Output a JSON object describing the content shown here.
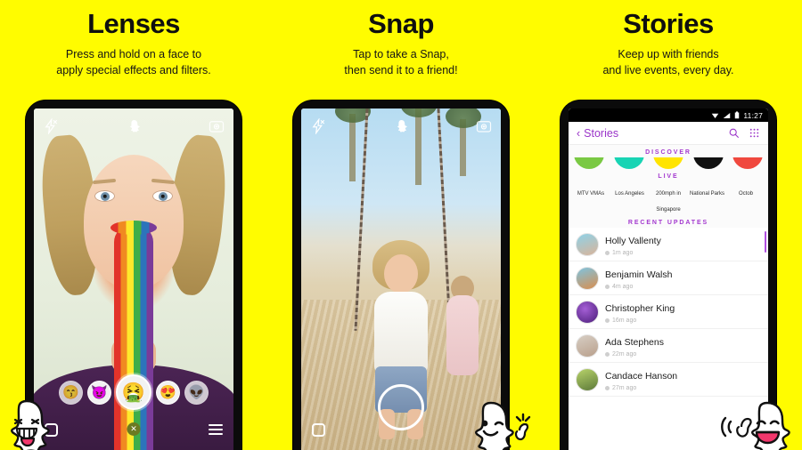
{
  "background_color": "#FFFC00",
  "panels": [
    {
      "id": "lenses",
      "title": "Lenses",
      "subtitle_line1": "Press and hold on a face to",
      "subtitle_line2": "apply special effects and filters.",
      "camera": {
        "flash_icon": "flash-off-icon",
        "logo_icon": "snapchat-ghost-icon",
        "add_friend_icon": "add-friend-camera-icon",
        "gallery_icon": "memories-gallery-icon",
        "menu_icon": "hamburger-menu-icon",
        "close_lens_icon": "close-lens-icon",
        "lenses": [
          {
            "name": "lens-kiss",
            "glyph": "😙"
          },
          {
            "name": "lens-devil",
            "glyph": "😈"
          },
          {
            "name": "lens-rainbow-vomit",
            "glyph": "🤮",
            "selected": true
          },
          {
            "name": "lens-hearts",
            "glyph": "😍"
          },
          {
            "name": "lens-alien",
            "glyph": "👽"
          }
        ]
      }
    },
    {
      "id": "snap",
      "title": "Snap",
      "subtitle_line1": "Tap to take a Snap,",
      "subtitle_line2": "then send it to a friend!",
      "camera": {
        "flash_icon": "flash-off-icon",
        "logo_icon": "snapchat-ghost-icon",
        "add_friend_icon": "add-friend-camera-icon",
        "gallery_icon": "memories-gallery-icon",
        "shutter_icon": "shutter-button"
      }
    },
    {
      "id": "stories",
      "title": "Stories",
      "subtitle_line1": "Keep up with friends",
      "subtitle_line2": "and live events, every day."
    }
  ],
  "stories_screen": {
    "status_bar": {
      "time": "11:27",
      "wifi_icon": "wifi-icon",
      "signal_icon": "signal-bars-icon",
      "battery_icon": "battery-icon"
    },
    "header": {
      "back_icon": "chevron-left-icon",
      "title": "Stories",
      "search_icon": "search-icon",
      "grid_icon": "grid-dots-icon",
      "accent_color": "#9a34c9"
    },
    "discover": {
      "label": "DISCOVER",
      "tiles": [
        {
          "name": "discover-tile-1",
          "color": "#7ac943"
        },
        {
          "name": "discover-tile-2",
          "color": "#18d4b4"
        },
        {
          "name": "discover-tile-3",
          "color": "#ffe400"
        },
        {
          "name": "discover-tile-4",
          "color": "#111111"
        },
        {
          "name": "discover-tile-5",
          "color": "#f0483e"
        }
      ]
    },
    "live": {
      "label": "LIVE",
      "tiles": [
        {
          "name": "live-tile-mtv-vmas",
          "caption": "MTV VMAs",
          "color": "#3ad6e0"
        },
        {
          "name": "live-tile-los-angeles",
          "caption": "Los Angeles",
          "color": "#6cc6e8"
        },
        {
          "name": "live-tile-200mph-singapore",
          "caption": "200mph in Singapore",
          "color": "#1b0b22"
        },
        {
          "name": "live-tile-national-parks",
          "caption": "National Parks",
          "color": "#8cc4de"
        },
        {
          "name": "live-tile-oktoberfest",
          "caption": "Octob",
          "color": "#2f6fc4"
        }
      ]
    },
    "recent_updates": {
      "label": "RECENT UPDATES",
      "items": [
        {
          "name": "Holly Vallenty",
          "time": "1m ago",
          "avatar_color": "#8fd2e8"
        },
        {
          "name": "Benjamin Walsh",
          "time": "4m ago",
          "avatar_color": "#d9a06a"
        },
        {
          "name": "Christopher King",
          "time": "16m ago",
          "avatar_color": "#6a2f9e"
        },
        {
          "name": "Ada Stephens",
          "time": "22m ago",
          "avatar_color": "#cfc2b4"
        },
        {
          "name": "Candace Hanson",
          "time": "27m ago",
          "avatar_color": "#90a85e"
        }
      ]
    }
  },
  "stickers": [
    {
      "name": "ghost-sticker-tongue-out",
      "expression": "grinning-tongue"
    },
    {
      "name": "ghost-sticker-winking",
      "expression": "wink-smile"
    },
    {
      "name": "ghost-sticker-laughing-waving",
      "expression": "laughing-wave"
    }
  ]
}
